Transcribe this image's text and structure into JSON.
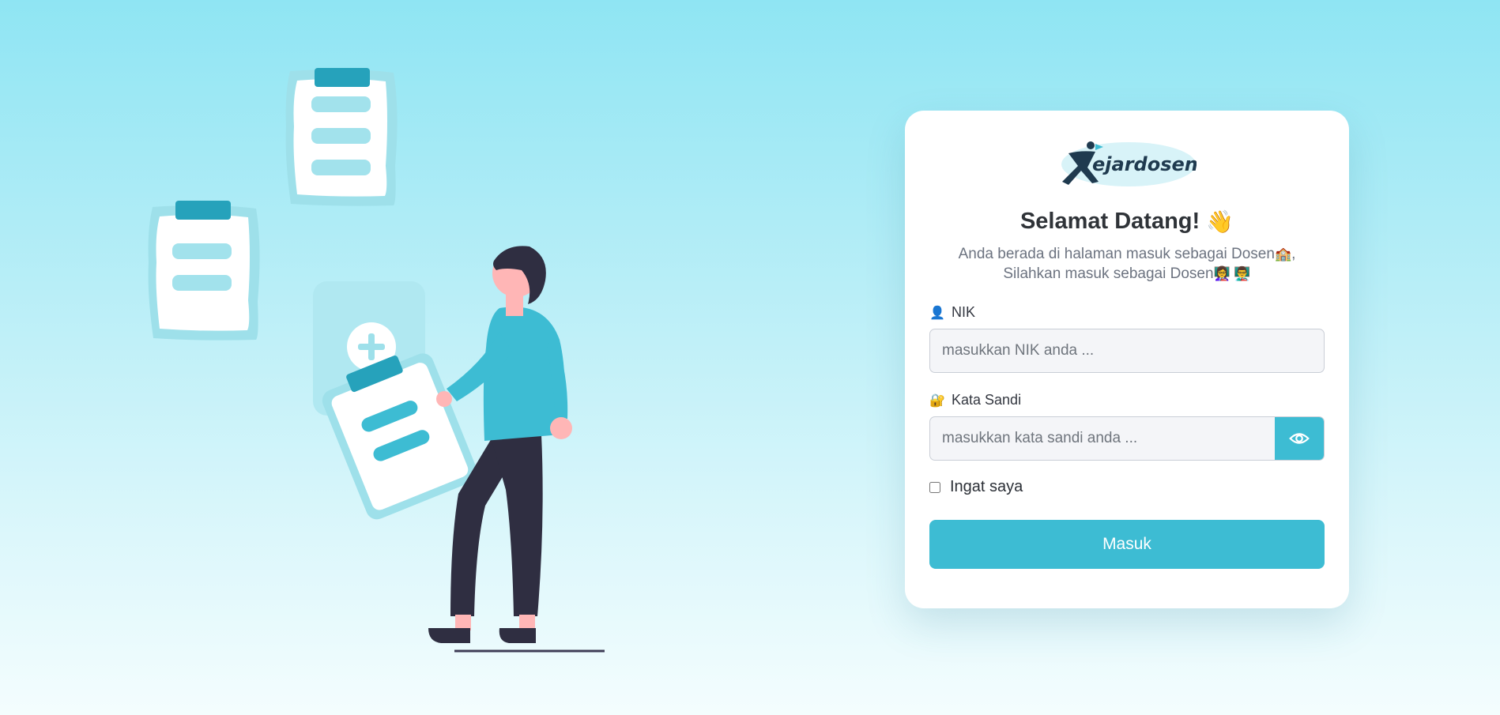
{
  "brand": {
    "logo_text": "ejardosen",
    "primary_color": "#3dbcd3"
  },
  "card": {
    "title": "Selamat Datang!",
    "title_emoji": "👋",
    "subtitle_part1": "Anda berada di halaman masuk sebagai Dosen",
    "subtitle_emoji1": "🏫",
    "subtitle_part2": ", Silahkan masuk sebagai Dosen",
    "subtitle_emoji2": "👩‍🏫 👨‍🏫"
  },
  "form": {
    "nik": {
      "label": "NIK",
      "icon": "👤",
      "placeholder": "masukkan NIK anda ..."
    },
    "password": {
      "label": "Kata Sandi",
      "icon": "🔐",
      "placeholder": "masukkan kata sandi anda ...",
      "toggle_icon": "eye-icon"
    },
    "remember": {
      "label": "Ingat saya",
      "checked": false
    },
    "submit_label": "Masuk"
  }
}
